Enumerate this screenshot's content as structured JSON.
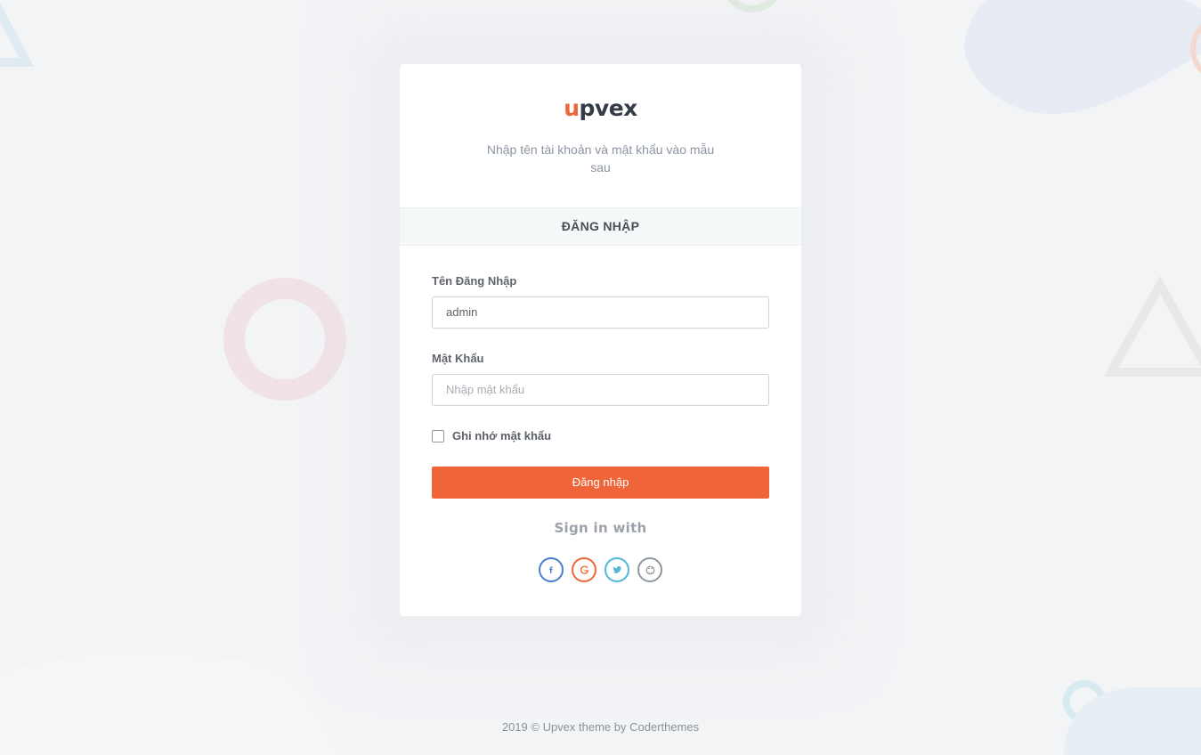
{
  "brand": {
    "logo_text_u": "u",
    "logo_text_rest": "pvex",
    "accent_color": "#ef6539",
    "dark_color": "#353c48"
  },
  "header": {
    "subtitle": "Nhập tên tài khoản và mật khẩu vào mẫu sau"
  },
  "section": {
    "title": "ĐĂNG NHẬP"
  },
  "form": {
    "username_label": "Tên Đăng Nhập",
    "username_value": "admin",
    "password_label": "Mật Khẩu",
    "password_placeholder": "Nhập mật khẩu",
    "remember_label": "Ghi nhớ mật khẩu",
    "remember_checked": false,
    "submit_label": "Đăng nhập"
  },
  "social": {
    "heading": "Sign in with",
    "buttons": [
      {
        "icon": "facebook-icon",
        "glyph": "f",
        "color": "#4a7fd0"
      },
      {
        "icon": "google-icon",
        "glyph": "G",
        "color": "#ef6539"
      },
      {
        "icon": "twitter-icon",
        "glyph": "t",
        "color": "#4fb8d8"
      },
      {
        "icon": "github-icon",
        "glyph": "gh",
        "color": "#8f98a3"
      }
    ]
  },
  "footer": {
    "text": "2019 © Upvex theme by Coderthemes"
  }
}
